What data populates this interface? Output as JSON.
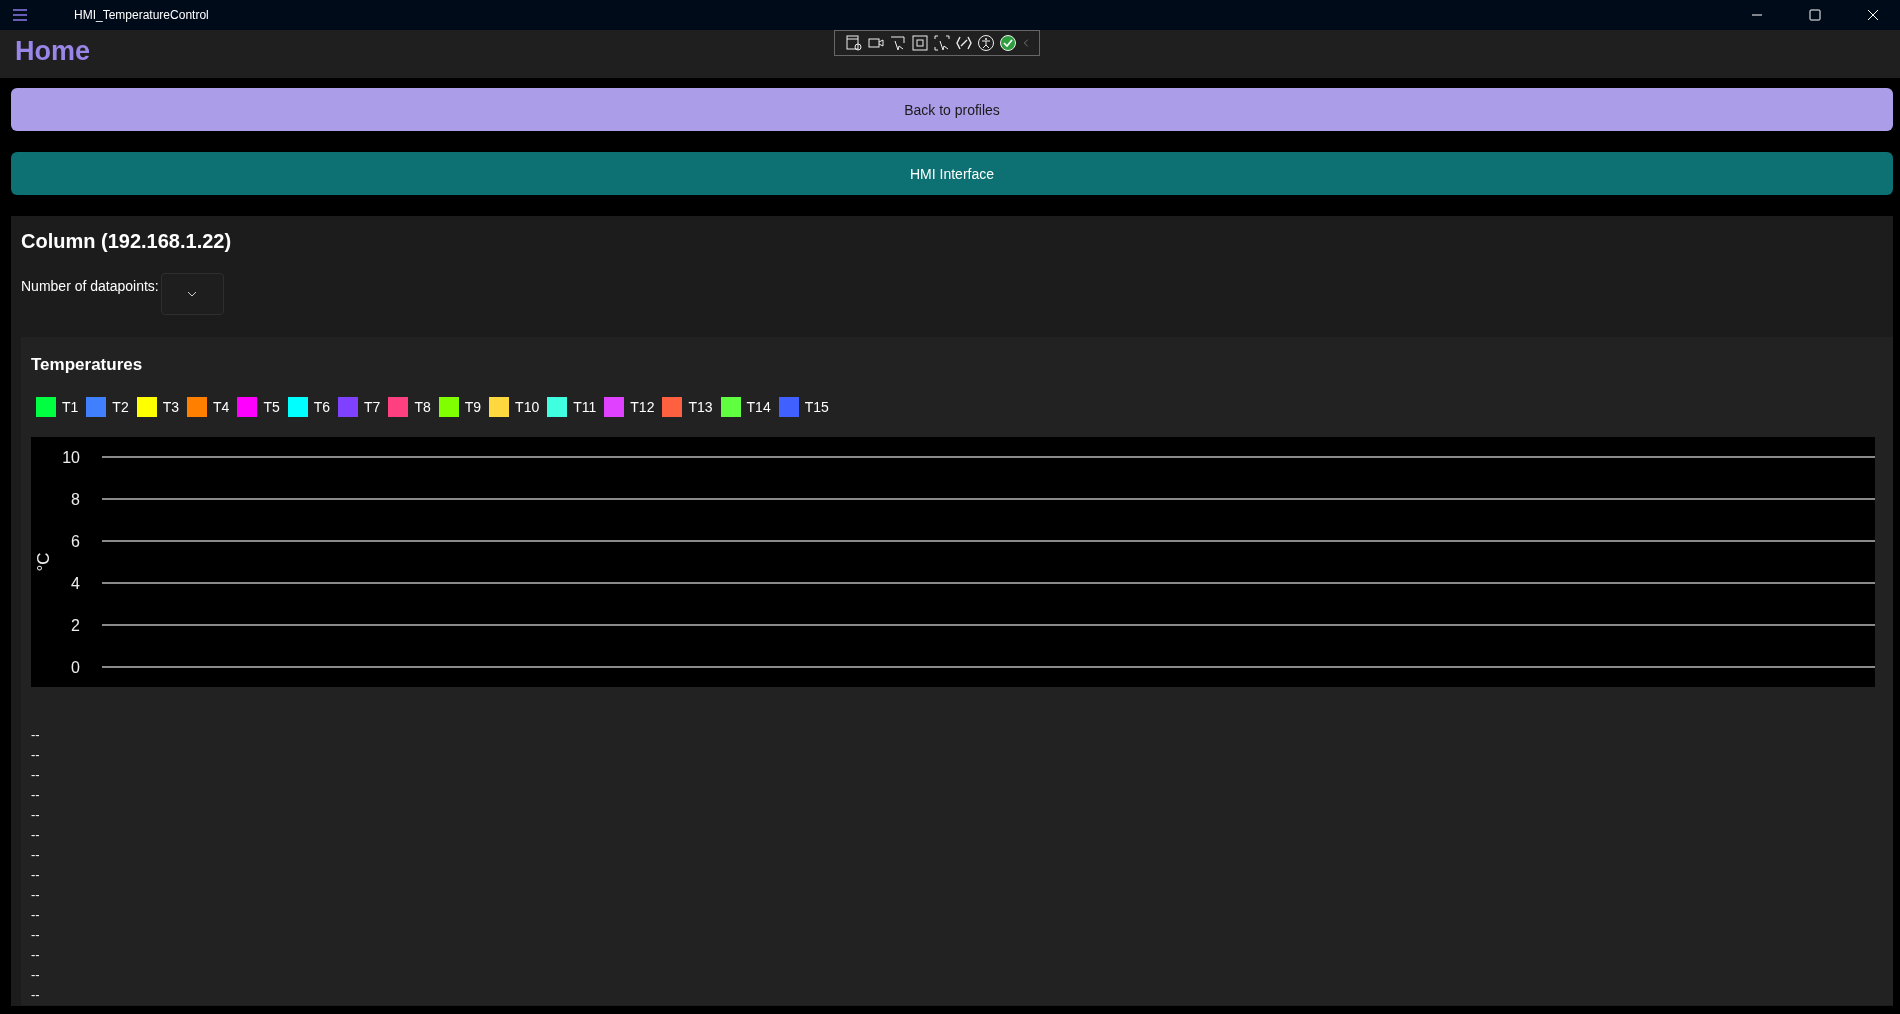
{
  "window": {
    "title": "HMI_TemperatureControl"
  },
  "page": {
    "title": "Home"
  },
  "buttons": [
    {
      "label": "Back to profiles",
      "kind": "secondary"
    },
    {
      "label": "HMI Interface",
      "kind": "primary"
    }
  ],
  "device": {
    "title": "Column (192.168.1.22)",
    "datapoints": {
      "label": "Number of datapoints:"
    }
  },
  "temperatures": {
    "title": "Temperatures",
    "chart_data": {
      "type": "line",
      "grid": true,
      "ylabel": "°C",
      "ylim": [
        0,
        10
      ],
      "yticks": [
        0,
        2,
        4,
        6,
        8,
        10
      ],
      "series": [
        {
          "name": "T1",
          "color": "#00ff40"
        },
        {
          "name": "T2",
          "color": "#4080ff"
        },
        {
          "name": "T3",
          "color": "#ffff00"
        },
        {
          "name": "T4",
          "color": "#ff8000"
        },
        {
          "name": "T5",
          "color": "#ff00ff"
        },
        {
          "name": "T6",
          "color": "#00ffff"
        },
        {
          "name": "T7",
          "color": "#8040ff"
        },
        {
          "name": "T8",
          "color": "#ff4080"
        },
        {
          "name": "T9",
          "color": "#80ff00"
        },
        {
          "name": "T10",
          "color": "#ffd840"
        },
        {
          "name": "T11",
          "color": "#40ffe0"
        },
        {
          "name": "T12",
          "color": "#e040ff"
        },
        {
          "name": "T13",
          "color": "#ff6040"
        },
        {
          "name": "T14",
          "color": "#60ff40"
        },
        {
          "name": "T15",
          "color": "#4060ff"
        }
      ]
    },
    "readings": [
      "--",
      "--",
      "--",
      "--",
      "--",
      "--",
      "--",
      "--",
      "--",
      "--",
      "--",
      "--",
      "--",
      "--"
    ]
  }
}
